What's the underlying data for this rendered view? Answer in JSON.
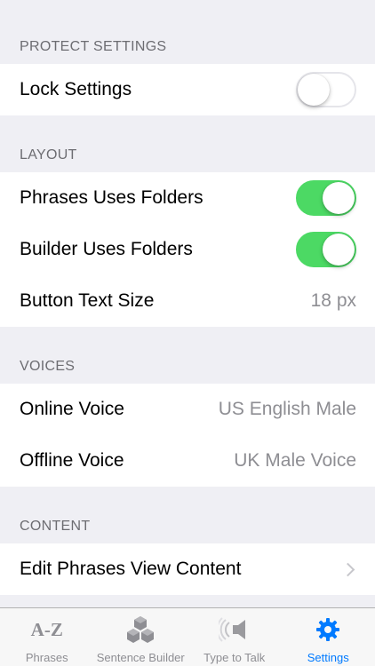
{
  "sections": {
    "protect": {
      "header": "PROTECT SETTINGS",
      "lock_settings": {
        "label": "Lock Settings",
        "enabled": false
      }
    },
    "layout": {
      "header": "LAYOUT",
      "phrases_folders": {
        "label": "Phrases Uses Folders",
        "enabled": true
      },
      "builder_folders": {
        "label": "Builder Uses Folders",
        "enabled": true
      },
      "button_text_size": {
        "label": "Button Text Size",
        "value": "18 px"
      }
    },
    "voices": {
      "header": "VOICES",
      "online_voice": {
        "label": "Online Voice",
        "value": "US English Male"
      },
      "offline_voice": {
        "label": "Offline Voice",
        "value": "UK Male Voice"
      }
    },
    "content": {
      "header": "CONTENT",
      "edit_phrases": {
        "label": "Edit Phrases View Content"
      }
    }
  },
  "tabbar": {
    "tabs": [
      {
        "label": "Phrases",
        "icon": "az-icon",
        "icon_text": "A-Z",
        "active": false
      },
      {
        "label": "Sentence Builder",
        "icon": "blocks-icon",
        "active": false
      },
      {
        "label": "Type to Talk",
        "icon": "speaker-icon",
        "active": false
      },
      {
        "label": "Settings",
        "icon": "gear-icon",
        "active": true
      }
    ]
  },
  "colors": {
    "background": "#efeff4",
    "toggle_on": "#4cd964",
    "active_tab": "#007aff",
    "inactive_tab": "#8e8e93",
    "secondary_text": "#8e8e93"
  }
}
